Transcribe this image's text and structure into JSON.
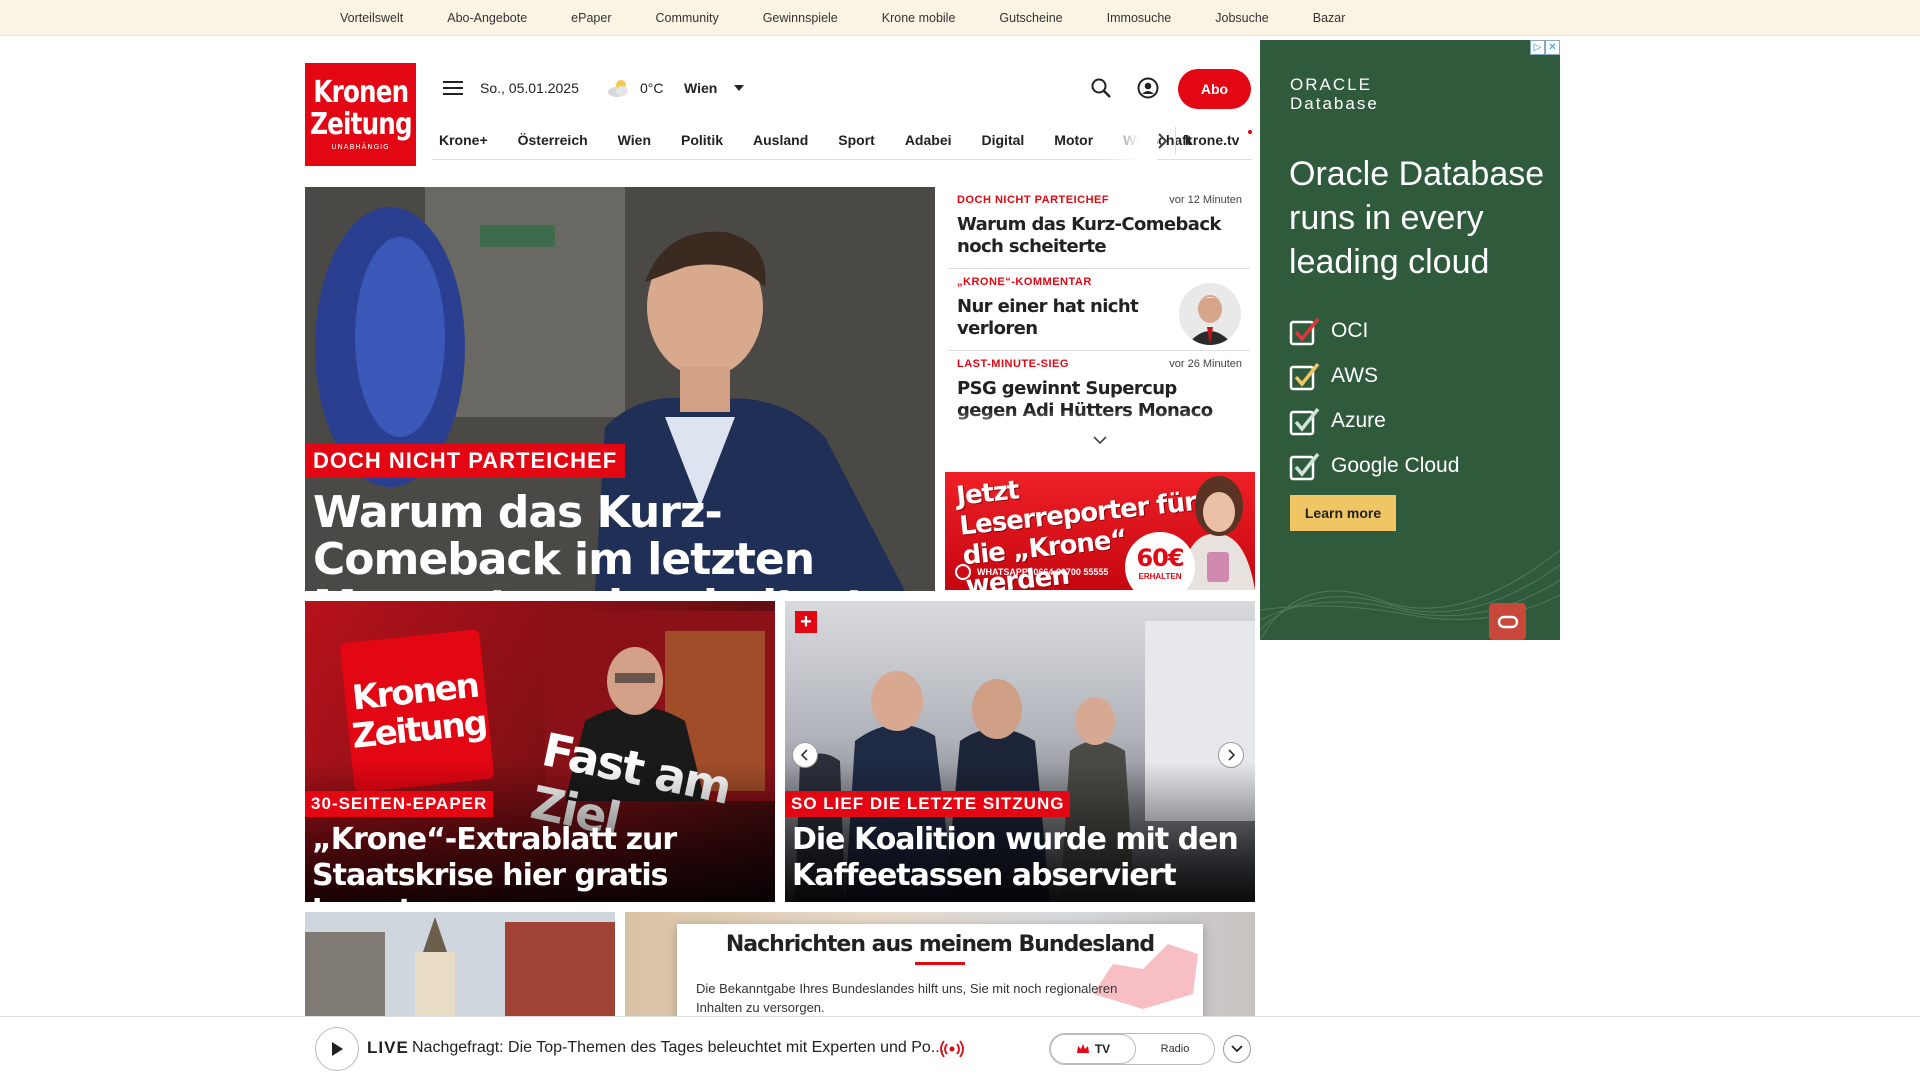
{
  "topbar": {
    "links": [
      "Vorteilswelt",
      "Abo-Angebote",
      "ePaper",
      "Community",
      "Gewinnspiele",
      "Krone mobile",
      "Gutscheine",
      "Immosuche",
      "Jobsuche",
      "Bazar"
    ]
  },
  "logo": {
    "line1": "Kronen",
    "line2": "Zeitung",
    "line3": "UNABHÄNGIG"
  },
  "header": {
    "date": "So., 05.01.2025",
    "temperature": "0°C",
    "city": "Wien",
    "abo_label": "Abo"
  },
  "nav": {
    "items": [
      "Krone+",
      "Österreich",
      "Wien",
      "Politik",
      "Ausland",
      "Sport",
      "Adabei",
      "Digital",
      "Motor",
      "Wirtschaft"
    ],
    "kronetv": "krone.tv"
  },
  "hero": {
    "kicker": "DOCH NICHT PARTEICHEF",
    "title": "Warum das Kurz-Comeback im letzten Moment noch scheiterte"
  },
  "side_news": [
    {
      "kicker": "DOCH NICHT PARTEICHEF",
      "time": "vor 12 Minuten",
      "title": "Warum das Kurz-Comeback noch scheiterte"
    },
    {
      "kicker": "„KRONE“-KOMMENTAR",
      "time": "",
      "title": "Nur einer hat nicht verloren"
    },
    {
      "kicker": "LAST-MINUTE-SIEG",
      "time": "vor 26 Minuten",
      "title": "PSG gewinnt Supercup gegen Adi Hütters Monaco"
    }
  ],
  "banner": {
    "headline": "Jetzt Leserreporter für die „Krone“ werden",
    "whatsapp": "WHATSAPP: 0664 60700 55555",
    "amount": "60€",
    "amount_sub": "ERHALTEN"
  },
  "ad": {
    "brand_line1": "ORACLE",
    "brand_line2": "Database",
    "headline": "Oracle Database runs in every leading cloud",
    "list": [
      "OCI",
      "AWS",
      "Azure",
      "Google Cloud"
    ],
    "cta": "Learn more",
    "close_icons": [
      "▷",
      "✕"
    ]
  },
  "cards": [
    {
      "kicker": "30-SEITEN-EPAPER",
      "title": "„Krone“-Extrablatt zur Staatskrise hier gratis lesen!",
      "img_logo1": "Kronen",
      "img_logo2": "Zeitung",
      "img_headline": "Fast am Ziel"
    },
    {
      "kicker": "SO LIEF DIE LETZTE SITZUNG",
      "title": "Die Koalition wurde mit den Kaffeetassen abserviert",
      "plus": "+"
    }
  ],
  "region_modal": {
    "title": "Nachrichten aus meinem Bundesland",
    "text": "Die Bekanntgabe Ihres Bundeslandes hilft uns, Sie mit noch regionaleren Inhalten zu versorgen."
  },
  "player": {
    "live": "LIVE",
    "title": "Nachgefragt: Die Top-Themen des Tages beleuchtet mit Experten und Po...",
    "tv": "TV",
    "radio": "Radio"
  },
  "colors": {
    "brand_red": "#e30613",
    "ad_green": "#2f5a3c",
    "ad_cta": "#f0c564"
  }
}
